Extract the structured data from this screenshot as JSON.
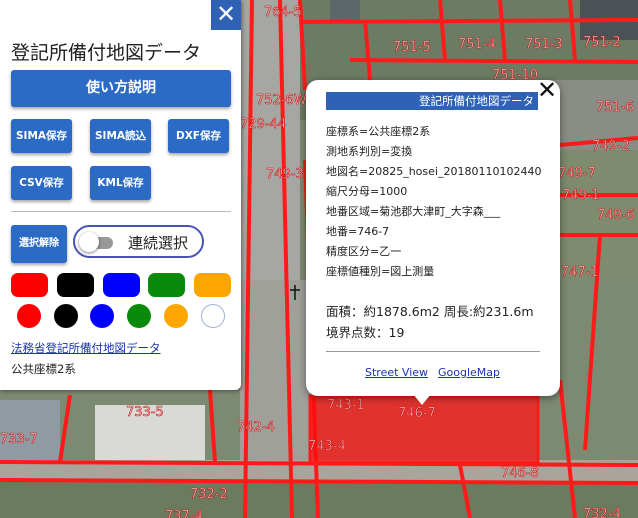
{
  "panel": {
    "close_label": "✕",
    "title": "登記所備付地図データ",
    "main_button": "使い方説明",
    "buttons_row1": [
      "SIMA保存",
      "SIMA読込",
      "DXF保存"
    ],
    "buttons_row2": [
      "CSV保存",
      "KML保存"
    ],
    "clear_button": "選択解除",
    "toggle_label": "連続選択",
    "square_colors": [
      "#ff0000",
      "#000000",
      "#0000ff",
      "#0a8a0a",
      "#ffa500"
    ],
    "circle_colors": [
      "#ff0000",
      "#000000",
      "#0000ff",
      "#0a8a0a",
      "#ffa500",
      "#ffffff"
    ],
    "link": "法務省登記所備付地図データ",
    "coord_system": "公共座標2系"
  },
  "popup": {
    "close_label": "✕",
    "header": "登記所備付地図データ",
    "lines": [
      "座標系=公共座標2系",
      "測地系判別=変換",
      "地図名=20825_hosei_20180110102440",
      "縮尺分母=1000",
      "地番区域=菊池郡大津町_大字森___",
      "地番=746-7",
      "精度区分=乙一",
      "座標値種別=図上測量"
    ],
    "area_line": "面積：約1878.6m2 周長:約231.6m",
    "points_line": "境界点数：19",
    "street_view": "Street View",
    "google_map": "GoogleMap"
  },
  "map_labels": [
    {
      "id": "764-5",
      "text": "764-5"
    },
    {
      "id": "751-5",
      "text": "751-5"
    },
    {
      "id": "751-4",
      "text": "751-4"
    },
    {
      "id": "751-3",
      "text": "751-3"
    },
    {
      "id": "751-2",
      "text": "751-2"
    },
    {
      "id": "751-10",
      "text": "751-10"
    },
    {
      "id": "751-6",
      "text": "751-6"
    },
    {
      "id": "752-6w",
      "text": "752-6W"
    },
    {
      "id": "729-44",
      "text": "729-44"
    },
    {
      "id": "749-2",
      "text": "749-2"
    },
    {
      "id": "749-7",
      "text": "749-7"
    },
    {
      "id": "749-3",
      "text": "749-3"
    },
    {
      "id": "749-6",
      "text": "749-6"
    },
    {
      "id": "749-1",
      "text": "749-1"
    },
    {
      "id": "747-1",
      "text": "747-1"
    },
    {
      "id": "733-5",
      "text": "733-5"
    },
    {
      "id": "742-4",
      "text": "742-4"
    },
    {
      "id": "743-1",
      "text": "743-1"
    },
    {
      "id": "746-7",
      "text": "746-7"
    },
    {
      "id": "743-4",
      "text": "743-4"
    },
    {
      "id": "746-8",
      "text": "746-8"
    },
    {
      "id": "733-7",
      "text": "733-7"
    },
    {
      "id": "732-2",
      "text": "732-2"
    },
    {
      "id": "737-4",
      "text": "737-4"
    },
    {
      "id": "732-4",
      "text": "732-4"
    }
  ]
}
